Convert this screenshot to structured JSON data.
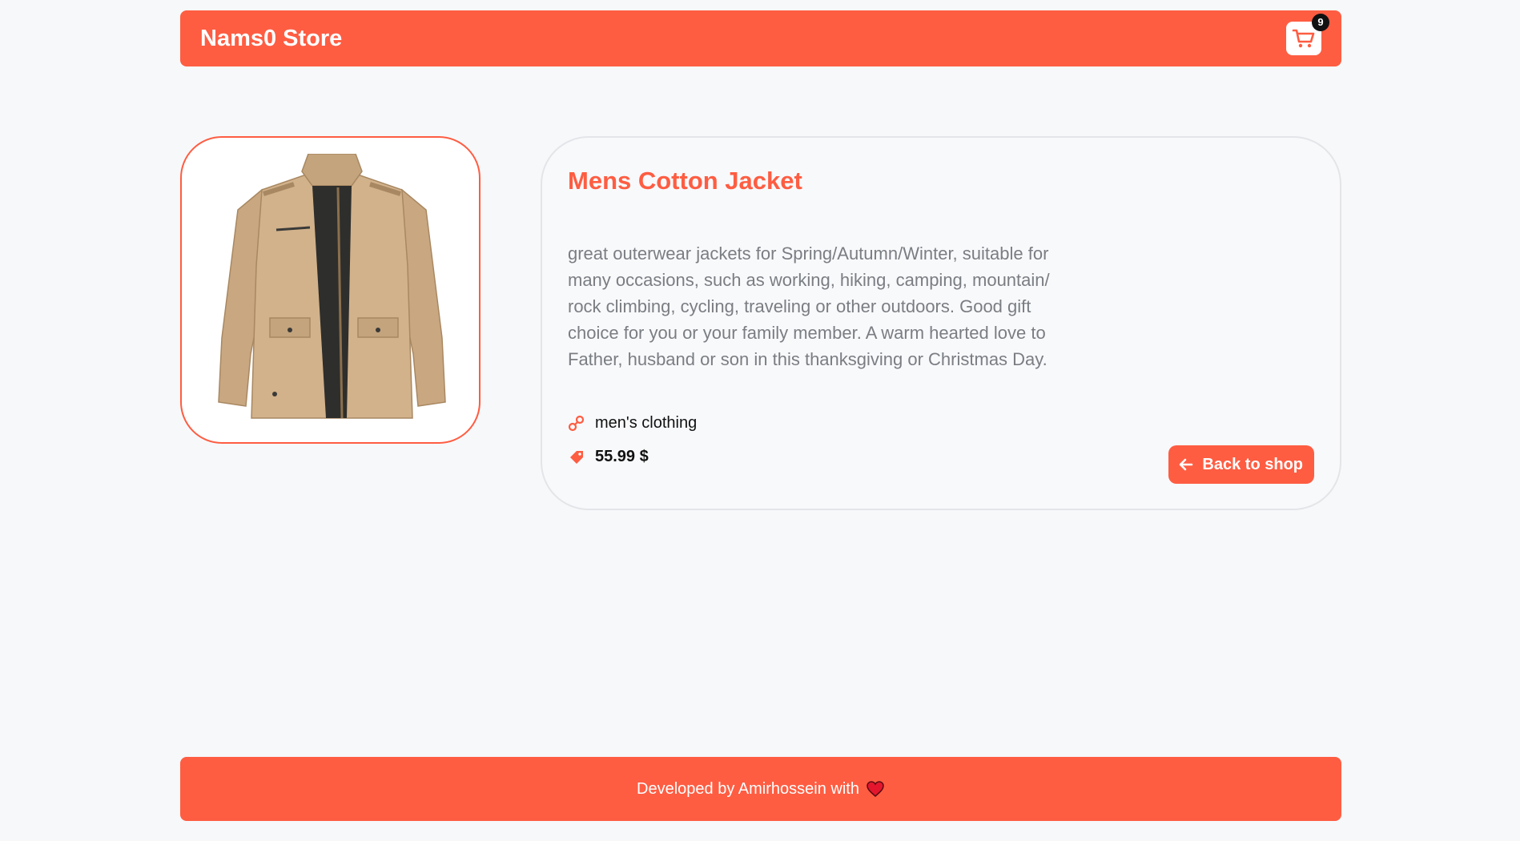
{
  "header": {
    "brand": "Nams0 Store",
    "cart_icon": "shopping-cart-icon",
    "cart_count": "9"
  },
  "product": {
    "image_icon": "jacket-image",
    "title": "Mens Cotton Jacket",
    "description": "great outerwear jackets for Spring/Autumn/Winter, suitable for many occasions, such as working, hiking, camping, mountain/ rock climbing, cycling, traveling or other outdoors. Good gift choice for you or your family member. A warm hearted love to Father, husband or son in this thanksgiving or Christmas Day.",
    "category_icon": "category-link-icon",
    "category": "men's clothing",
    "price_icon": "price-tag-icon",
    "price": "55.99 $"
  },
  "actions": {
    "back_icon": "arrow-left-icon",
    "back_label": "Back to shop"
  },
  "footer": {
    "text": "Developed by Amirhossein with",
    "heart_icon": "heart-icon"
  },
  "colors": {
    "accent": "#fe5d42",
    "background": "#f7f8fa",
    "text_muted": "#7a7d82",
    "card_border": "#e3e5e8"
  }
}
